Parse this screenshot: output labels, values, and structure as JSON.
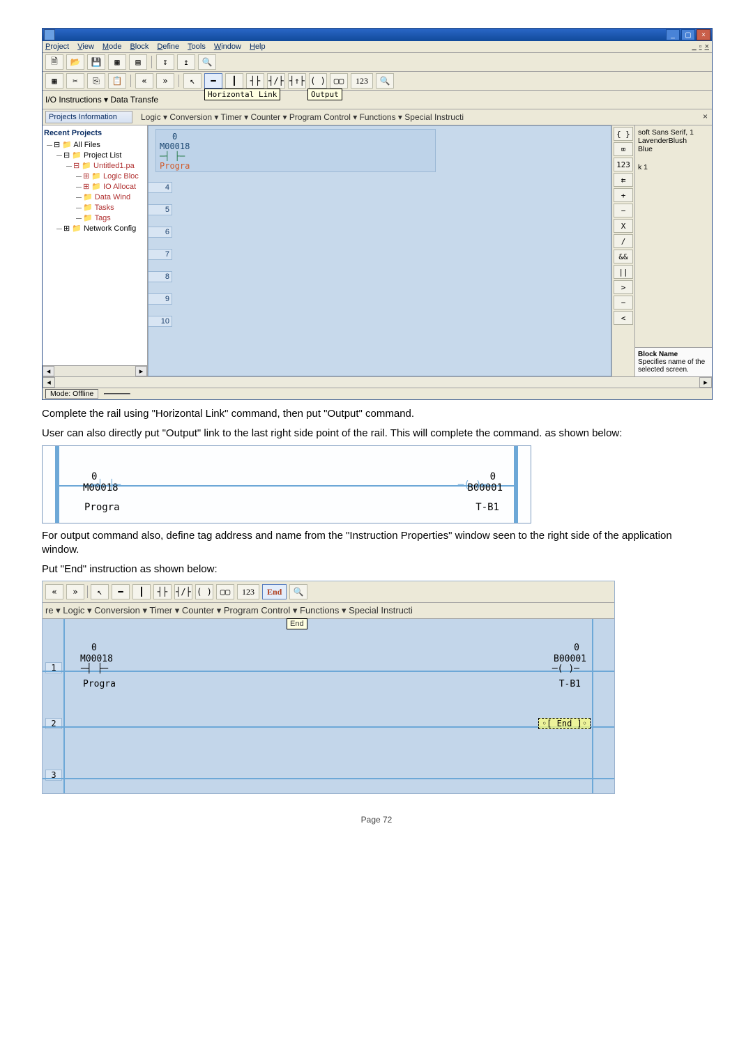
{
  "page_footer": "Page 72",
  "body_text": {
    "p1": "Complete the rail using \"Horizontal Link\" command, then put \"Output\" command.",
    "p2": "User can also directly put \"Output\" link to the last right side point of the rail. This will complete the command. as shown below:",
    "p3": "For output command also, define tag address and name from the \"Instruction Properties\" window seen to the right side of the application window.",
    "p4": "Put \"End\" instruction as shown below:"
  },
  "menus": [
    "Project",
    "View",
    "Mode",
    "Block",
    "Define",
    "Tools",
    "Window",
    "Help"
  ],
  "toolbar_io_label": "I/O Instructions ▾   Data Transfe",
  "toolbar_labels": {
    "num": "123",
    "arrow_left": "«",
    "arrow_right": "»"
  },
  "tooltips": {
    "hlink": "Horizontal Link",
    "output": "Output",
    "end": "End"
  },
  "category_row": "Logic ▾   Conversion ▾   Timer ▾   Counter ▾   Program Control ▾   Functions ▾   Special Instructi",
  "left_panel": {
    "title": "Projects Information",
    "recent": "Recent Projects",
    "tree": {
      "root": "All Files",
      "items": [
        "Project List",
        "Untitled1.pa",
        "Logic Bloc",
        "IO Allocat",
        "Data Wind",
        "Tasks",
        "Tags",
        "Network Config"
      ]
    }
  },
  "right_panel": {
    "top_lines": [
      "soft Sans Serif, 1",
      "LavenderBlush",
      "Blue",
      "k 1"
    ],
    "bottom_title": "Block Name",
    "bottom_desc": "Specifies name of the selected screen."
  },
  "ladder_main": {
    "rung_zero": "0",
    "addr": "M00018",
    "progra": "Progra",
    "row_numbers": [
      "4",
      "5",
      "6",
      "7",
      "8",
      "9",
      "10"
    ]
  },
  "palette_items": [
    "{ }",
    "⌧",
    "123",
    "⇇",
    "+",
    "−",
    "X",
    "/",
    "&&",
    "||",
    ">",
    "−",
    "<"
  ],
  "statusbar": {
    "mode": "Mode: Offline"
  },
  "rail": {
    "zero_l": "0",
    "zero_r": "0",
    "addr": "M00018",
    "out": "B00001",
    "progra": "Progra",
    "tb1": "T-B1"
  },
  "end_img": {
    "toolbar_num": "123",
    "toolbar_end": "End",
    "cat": "re ▾   Logic ▾   Conversion ▾   Timer ▾   Counter ▾   Program Control ▾   Functions ▾   Special Instructi",
    "tooltip": "End",
    "rows": {
      "n1": "1",
      "n2": "2",
      "n3": "3"
    },
    "left_zero": "0",
    "right_zero": "0",
    "addr": "M00018",
    "out": "B00001",
    "progra": "Progra",
    "tb1": "T-B1",
    "end_node": "End"
  }
}
